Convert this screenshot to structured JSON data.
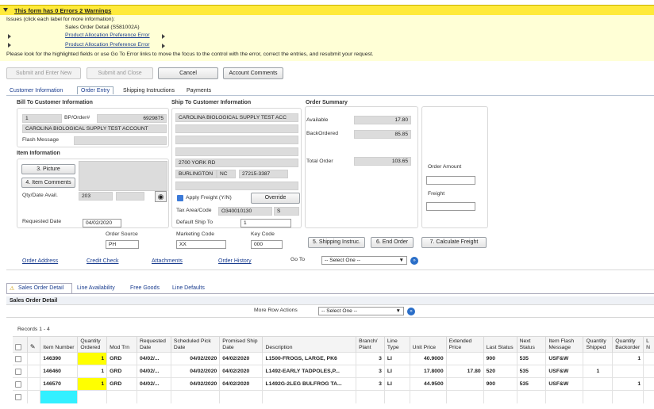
{
  "errors": {
    "title": "This form has 0 Errors 2 Warnings",
    "issues_label": "Issues (click each label for more information):",
    "items": [
      "Sales Order Detail (S581002A)",
      "Product Allocation Preference Error",
      "Product Allocation Preference Error"
    ],
    "instruction": "Please look for the highlighted fields or use Go To Error links to move the focus to the control with the error, correct the entries, and resubmit your request."
  },
  "toolbar": {
    "submit_new": "Submit and Enter New",
    "submit_close": "Submit and Close",
    "cancel": "Cancel",
    "account_comments": "Account Comments"
  },
  "tabs": [
    "Customer Information",
    "Order Entry",
    "Shipping Instructions",
    "Payments"
  ],
  "bill_to": {
    "header": "Bill To Customer Information",
    "number": "1",
    "bp_label": "BP/Order#",
    "bp_value": "6929875",
    "name": "CAROLINA BIOLOGICAL SUPPLY TEST ACCOUNT",
    "flash_label": "Flash Message",
    "flash_value": ""
  },
  "item_info": {
    "header": "Item Information",
    "picture_btn": "3. Picture",
    "comments_btn": "4. Item Comments",
    "qty_label": "Qty/Date Avail.",
    "qty_value": "203",
    "requested_label": "Requested Date",
    "requested_value": "04/02/2020"
  },
  "ship_to": {
    "header": "Ship To Customer Information",
    "name": "CAROLINA BIOLOGICAL SUPPLY TEST ACC",
    "address": "2700 YORK RD",
    "city": "BURLINGTON",
    "state": "NC",
    "zip": "27215-3387",
    "apply_freight": "Apply Freight (Y/N)",
    "override_btn": "Override",
    "tax_label": "Tax Area/Code",
    "tax_area": "O340010130",
    "tax_code": "S",
    "default_ship_label": "Default Ship To",
    "default_ship_value": "1"
  },
  "summary": {
    "header": "Order Summary",
    "available_label": "Available",
    "available_value": "17.80",
    "backordered_label": "BackOrdered",
    "backordered_value": "85.85",
    "total_label": "Total Order",
    "total_value": "103.65",
    "amount_label": "Order Amount",
    "freight_label": "Freight"
  },
  "order_fields": {
    "source_label": "Order Source",
    "source_value": "PH",
    "marketing_label": "Marketing Code",
    "marketing_value": "XX",
    "key_label": "Key Code",
    "key_value": "000",
    "ship_instr_btn": "5. Shipping Instruc.",
    "end_order_btn": "6. End Order",
    "calc_freight_btn": "7. Calculate Freight"
  },
  "links": {
    "order_address": "Order Address",
    "credit_check": "Credit Check",
    "attachments": "Attachments",
    "order_history": "Order History",
    "goto_label": "Go To",
    "goto_select": "-- Select One --"
  },
  "detail_tabs": [
    "Sales Order Detail",
    "Line Availability",
    "Free Goods",
    "Line Defaults"
  ],
  "detail": {
    "section_title": "Sales Order Detail",
    "more_row_actions": "More Row Actions",
    "row_select": "-- Select One --",
    "records": "Records 1 - 4",
    "columns": [
      "Item Number",
      "Quantity Ordered",
      "Mod Trn",
      "Requested Date",
      "Scheduled Pick Date",
      "Promised Ship Date",
      "Description",
      "Branch/ Plant",
      "Line Type",
      "Unit Price",
      "Extended Price",
      "Last Status",
      "Next Status",
      "Item Flash Message",
      "Quantity Shipped",
      "Quantity Backorder",
      "L N"
    ],
    "rows": [
      [
        "146390",
        "1",
        "GRD",
        "04/02/...",
        "04/02/2020",
        "04/02/2020",
        "L1500-FROGS, LARGE, PK6",
        "3",
        "LI",
        "40.9000",
        "",
        "900",
        "535",
        "USF&W",
        "",
        "1",
        ""
      ],
      [
        "146460",
        "1",
        "GRD",
        "04/02/...",
        "04/02/2020",
        "04/02/2020",
        "L1492-EARLY TADPOLES,P...",
        "3",
        "LI",
        "17.8000",
        "17.80",
        "520",
        "535",
        "USF&W",
        "1",
        "",
        ""
      ],
      [
        "146570",
        "1",
        "GRD",
        "04/02/...",
        "04/02/2020",
        "04/02/2020",
        "L1492G-2LEG BULFROG TA...",
        "3",
        "LI",
        "44.9500",
        "",
        "900",
        "535",
        "USF&W",
        "",
        "1",
        ""
      ]
    ]
  },
  "colors": {
    "warning_bar": "#ffea3a",
    "warning_bg": "#ffffd6",
    "highlight": "#ffff00",
    "new_row": "#33f0ff",
    "link": "#1a3d8f"
  }
}
